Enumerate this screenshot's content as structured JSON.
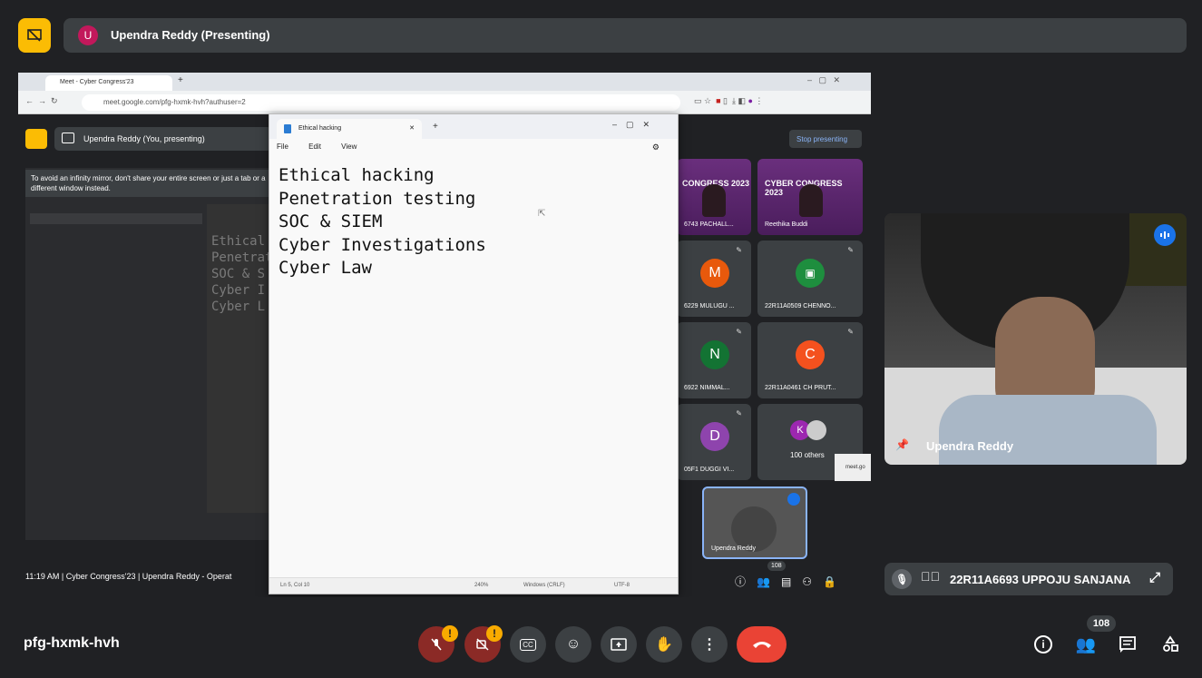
{
  "header": {
    "presenter_initial": "U",
    "presenter_label": "Upendra Reddy (Presenting)"
  },
  "shared_screen": {
    "chrome": {
      "tab_title": "Meet - Cyber Congress'23",
      "url": "meet.google.com/pfg-hxmk-hvh?authuser=2"
    },
    "inner_meet": {
      "presenting_label": "Upendra Reddy (You, presenting)",
      "stop_presenting": "Stop presenting",
      "mirror_message": "To avoid an infinity mirror, don't share your entire screen or just a tab or a different window instead.",
      "mirror_ghost_lines": [
        "Ethical",
        "Penetrat",
        "SOC & S",
        "Cyber I",
        "Cyber L"
      ],
      "bottom_info": "11:19 AM  |  Cyber Congress'23 | Upendra Reddy - Operat",
      "participant_count": "108",
      "tiles": [
        {
          "label": "6743 PACHALL...",
          "type": "congress",
          "banner": "CONGRESS 2023"
        },
        {
          "label": "Reethika Buddi",
          "type": "congress",
          "banner": "CYBER CONGRESS 2023"
        },
        {
          "label": "6229 MULUGU ...",
          "initial": "M",
          "color": "#e8590c"
        },
        {
          "label": "22R11A0509 CHENNO...",
          "initial": "",
          "color": "#1e8e3e"
        },
        {
          "label": "6922 NIMMAL...",
          "initial": "N",
          "color": "#137333"
        },
        {
          "label": "22R11A0461 CH PRUT...",
          "initial": "C",
          "color": "#f4511e"
        },
        {
          "label": "05F1 DUGGI VI...",
          "initial": "D",
          "color": "#8e44ad"
        },
        {
          "label": "100 others",
          "initial": "K",
          "color": "#9c27b0"
        }
      ],
      "self_tile_label": "Upendra Reddy",
      "popup_text": "meet.go"
    },
    "notepad": {
      "tab_title": "Ethical hacking",
      "menu": [
        "File",
        "Edit",
        "View"
      ],
      "lines": [
        "Ethical hacking",
        "Penetration testing",
        "SOC & SIEM",
        "Cyber Investigations",
        "Cyber Law"
      ],
      "status": {
        "position": "Ln 5, Col 10",
        "zoom": "240%",
        "line_ending": "Windows (CRLF)",
        "encoding": "UTF-8"
      }
    }
  },
  "speaker": {
    "name": "Upendra Reddy"
  },
  "self_view": {
    "name": "22R11A6693 UPPOJU SANJANA"
  },
  "bottom_bar": {
    "meeting_code": "pfg-hxmk-hvh",
    "participant_count": "108"
  },
  "colors": {
    "accent_yellow": "#fbbc04",
    "end_call_red": "#ea4335",
    "background": "#202124",
    "surface": "#3c4043"
  }
}
